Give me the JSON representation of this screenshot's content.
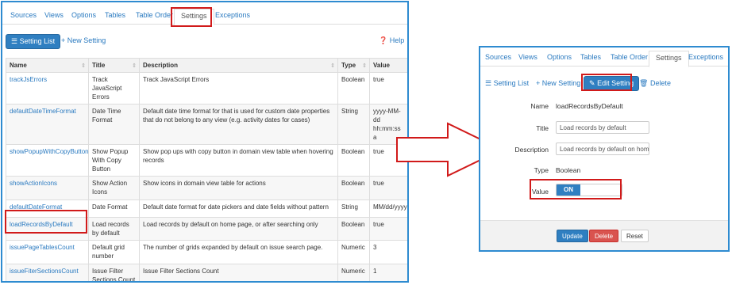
{
  "left": {
    "tabs": [
      "Sources",
      "Views",
      "Options",
      "Tables",
      "Table Order",
      "Settings",
      "Exceptions"
    ],
    "toolbar": {
      "setting_list": "Setting List",
      "new_setting": "New Setting",
      "help": "Help"
    },
    "table": {
      "columns": [
        "Name",
        "Title",
        "Description",
        "Type",
        "Value"
      ],
      "rows": [
        {
          "name": "trackJsErrors",
          "title": "Track JavaScript Errors",
          "description": "Track JavaScript Errors",
          "type": "Boolean",
          "value": "true"
        },
        {
          "name": "defaultDateTimeFormat",
          "title": "Date Time Format",
          "description": "Default date time format for that is used for custom date properties that do not belong to any view (e.g. activity dates for cases)",
          "type": "String",
          "value": "yyyy-MM-dd hh:mm:ss a"
        },
        {
          "name": "showPopupWithCopyButton",
          "title": "Show Popup With Copy Button",
          "description": "Show pop ups with copy button in domain view table when hovering records",
          "type": "Boolean",
          "value": "true"
        },
        {
          "name": "showActionIcons",
          "title": "Show Action Icons",
          "description": "Show icons in domain view table for actions",
          "type": "Boolean",
          "value": "true"
        },
        {
          "name": "defaultDateFormat",
          "title": "Date Format",
          "description": "Default date format for date pickers and date fields without pattern",
          "type": "String",
          "value": "MM/dd/yyyy"
        },
        {
          "name": "loadRecordsByDefault",
          "title": "Load records by default",
          "description": "Load records by default on home page, or after searching only",
          "type": "Boolean",
          "value": "true"
        },
        {
          "name": "issuePageTablesCount",
          "title": "Default grid number",
          "description": "The number of grids expanded by default on issue search page.",
          "type": "Numeric",
          "value": "3"
        },
        {
          "name": "issueFiterSectionsCount",
          "title": "Issue Filter Sections Count",
          "description": "Issue Filter Sections Count",
          "type": "Numeric",
          "value": "1"
        }
      ]
    }
  },
  "right": {
    "tabs": [
      "Sources",
      "Views",
      "Options",
      "Tables",
      "Table Order",
      "Settings",
      "Exceptions"
    ],
    "toolbar": {
      "setting_list": "Setting List",
      "new_setting": "New Setting",
      "edit_setting": "Edit Setting",
      "delete": "Delete"
    },
    "form": {
      "name_label": "Name",
      "name_value": "loadRecordsByDefault",
      "title_label": "Title",
      "title_value": "Load records by default",
      "description_label": "Description",
      "description_value": "Load records by default on home page",
      "type_label": "Type",
      "type_value": "Boolean",
      "value_label": "Value",
      "value_toggle": "ON"
    },
    "footer": {
      "update": "Update",
      "delete": "Delete",
      "reset": "Reset"
    }
  },
  "colors": {
    "accent": "#2f7fc1",
    "highlight": "#d11a1a",
    "panel_border": "#2e8bd0",
    "danger": "#d9534f"
  }
}
